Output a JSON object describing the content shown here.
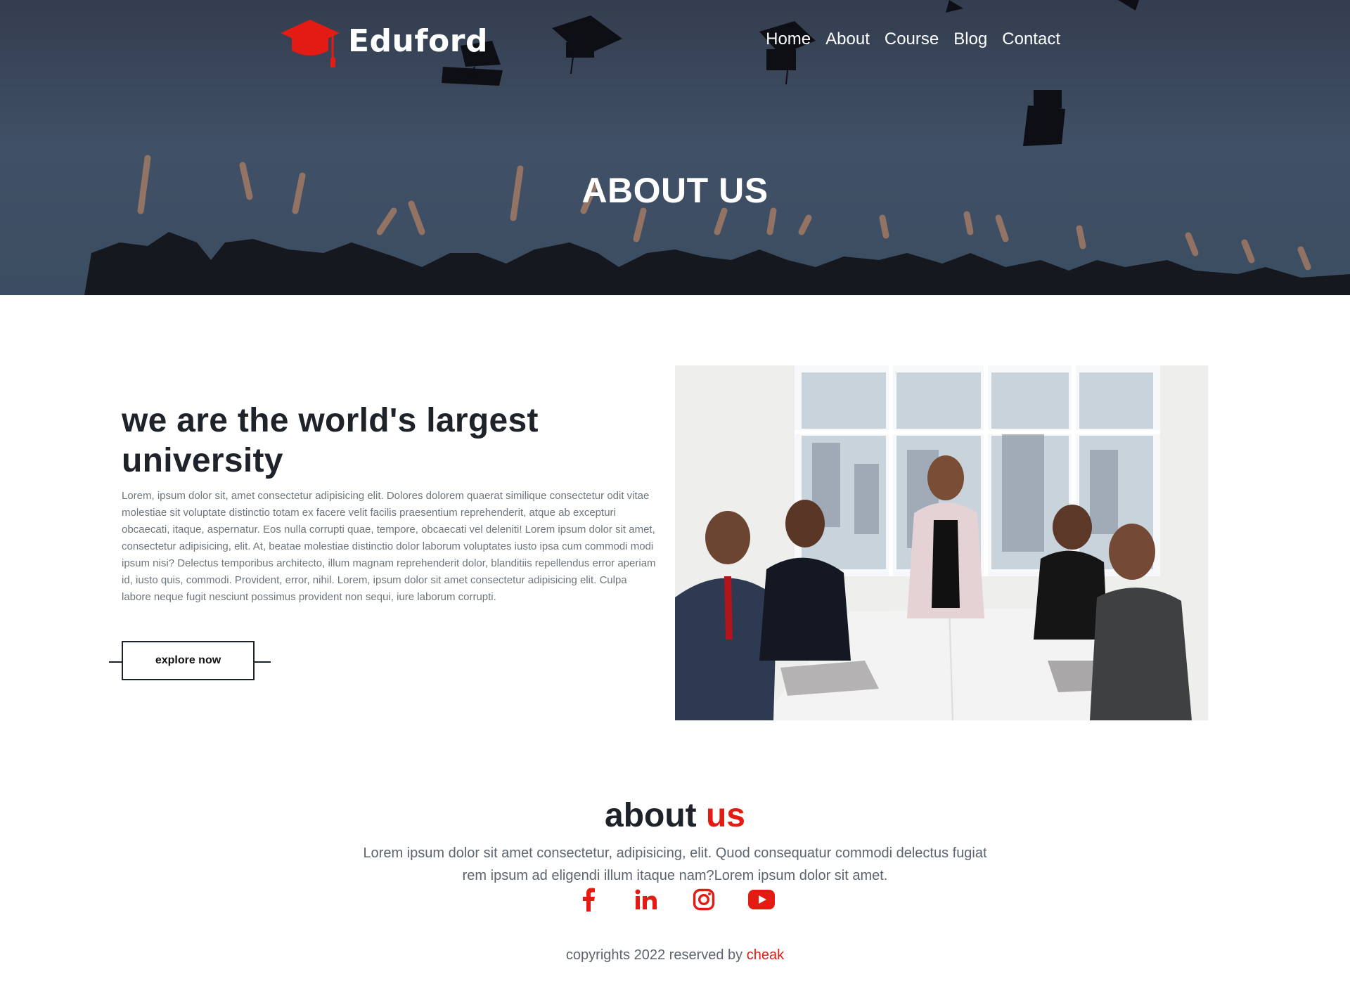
{
  "brand": {
    "name": "Eduford",
    "logo_icon": "graduation-cap-icon",
    "accent_color": "#e31b12"
  },
  "nav": {
    "items": [
      "Home",
      "About",
      "Course",
      "Blog",
      "Contact"
    ]
  },
  "hero": {
    "title": "ABOUT US"
  },
  "about": {
    "heading": "we are the world's largest university",
    "paragraph": "Lorem, ipsum dolor sit, amet consectetur adipisicing elit. Dolores dolorem quaerat similique consectetur odit vitae molestiae sit voluptate distinctio totam ex facere velit facilis praesentium reprehenderit, atque ab excepturi obcaecati, itaque, aspernatur. Eos nulla corrupti quae, tempore, obcaecati vel deleniti! Lorem ipsum dolor sit amet, consectetur adipisicing, elit. At, beatae molestiae distinctio dolor laborum voluptates iusto ipsa cum commodi modi ipsum nisi? Delectus temporibus architecto, illum magnam reprehenderit dolor, blanditiis repellendus error aperiam id, iusto quis, commodi. Provident, error, nihil. Lorem, ipsum dolor sit amet consectetur adipisicing elit. Culpa labore neque fugit nesciunt possimus provident non sequi, iure laborum corrupti.",
    "button_label": "explore now"
  },
  "footer": {
    "title_main": "about",
    "title_accent": "us",
    "text": "Lorem ipsum dolor sit amet consectetur, adipisicing, elit. Quod consequatur commodi delectus fugiat rem ipsum ad eligendi illum itaque nam?Lorem ipsum dolor sit amet.",
    "social_icons": [
      "facebook-icon",
      "linkedin-icon",
      "instagram-icon",
      "youtube-icon"
    ],
    "copyright_prefix": "copyrights 2022 reserved by",
    "copyright_brand": "cheak"
  }
}
